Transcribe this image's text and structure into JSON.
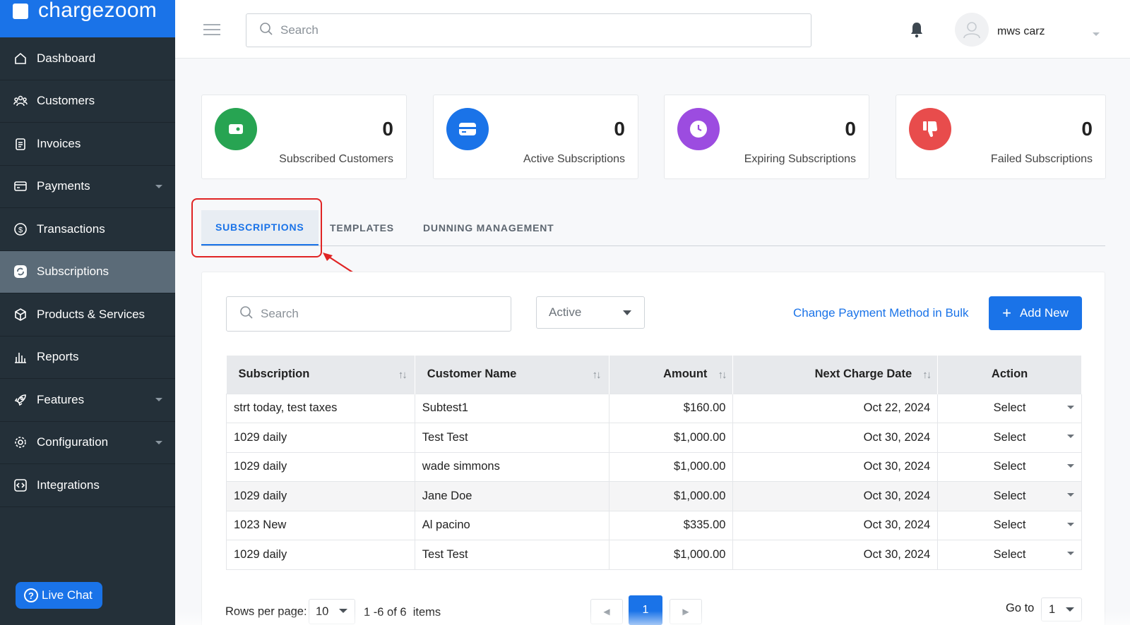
{
  "brand": {
    "name": "chargezoom"
  },
  "sidebar": {
    "items": [
      {
        "label": "Dashboard",
        "icon": "home-icon",
        "has_submenu": false,
        "active": false
      },
      {
        "label": "Customers",
        "icon": "users-icon",
        "has_submenu": false,
        "active": false
      },
      {
        "label": "Invoices",
        "icon": "invoice-icon",
        "has_submenu": false,
        "active": false
      },
      {
        "label": "Payments",
        "icon": "card-icon",
        "has_submenu": true,
        "active": false
      },
      {
        "label": "Transactions",
        "icon": "dollar-circle-icon",
        "has_submenu": false,
        "active": false
      },
      {
        "label": "Subscriptions",
        "icon": "refresh-icon",
        "has_submenu": false,
        "active": true
      },
      {
        "label": "Products & Services",
        "icon": "box-icon",
        "has_submenu": false,
        "active": false
      },
      {
        "label": "Reports",
        "icon": "bar-chart-icon",
        "has_submenu": false,
        "active": false
      },
      {
        "label": "Features",
        "icon": "rocket-icon",
        "has_submenu": true,
        "active": false
      },
      {
        "label": "Configuration",
        "icon": "gear-icon",
        "has_submenu": true,
        "active": false
      },
      {
        "label": "Integrations",
        "icon": "code-icon",
        "has_submenu": false,
        "active": false
      }
    ],
    "live_chat_label": "Live Chat"
  },
  "header": {
    "search_placeholder": "Search",
    "user_name": "mws carz"
  },
  "stats": [
    {
      "value": "0",
      "label": "Subscribed Customers",
      "color": "#27a452",
      "icon": "wallet-icon"
    },
    {
      "value": "0",
      "label": "Active Subscriptions",
      "color": "#1a73e8",
      "icon": "credit-card-icon"
    },
    {
      "value": "0",
      "label": "Expiring Subscriptions",
      "color": "#9c4ce0",
      "icon": "clock-icon"
    },
    {
      "value": "0",
      "label": "Failed Subscriptions",
      "color": "#e84c4c",
      "icon": "thumbs-down-icon"
    }
  ],
  "tabs": [
    {
      "label": "SUBSCRIPTIONS",
      "active": true
    },
    {
      "label": "TEMPLATES",
      "active": false
    },
    {
      "label": "DUNNING MANAGEMENT",
      "active": false
    }
  ],
  "toolbar": {
    "search_placeholder": "Search",
    "status_value": "Active",
    "bulk_link_label": "Change Payment Method in Bulk",
    "add_new_label": "Add New"
  },
  "table": {
    "columns": [
      "Subscription",
      "Customer Name",
      "Amount",
      "Next Charge Date",
      "Action"
    ],
    "rows": [
      {
        "subscription": "strt today, test taxes",
        "customer": "Subtest1",
        "amount": "$160.00",
        "next_charge": "Oct 22, 2024",
        "action": "Select"
      },
      {
        "subscription": "1029 daily",
        "customer": "Test Test",
        "amount": "$1,000.00",
        "next_charge": "Oct 30, 2024",
        "action": "Select"
      },
      {
        "subscription": "1029 daily",
        "customer": "wade simmons",
        "amount": "$1,000.00",
        "next_charge": "Oct 30, 2024",
        "action": "Select"
      },
      {
        "subscription": "1029 daily",
        "customer": "Jane Doe",
        "amount": "$1,000.00",
        "next_charge": "Oct 30, 2024",
        "action": "Select"
      },
      {
        "subscription": "1023 New",
        "customer": "Al pacino",
        "amount": "$335.00",
        "next_charge": "Oct 30, 2024",
        "action": "Select"
      },
      {
        "subscription": "1029 daily",
        "customer": "Test Test",
        "amount": "$1,000.00",
        "next_charge": "Oct 30, 2024",
        "action": "Select"
      }
    ]
  },
  "pagination": {
    "rows_per_page_label": "Rows per page:",
    "rows_per_page": "10",
    "items_info": "1 -6 of 6  items",
    "current_page": "1",
    "goto_label": "Go to",
    "goto_value": "1"
  }
}
